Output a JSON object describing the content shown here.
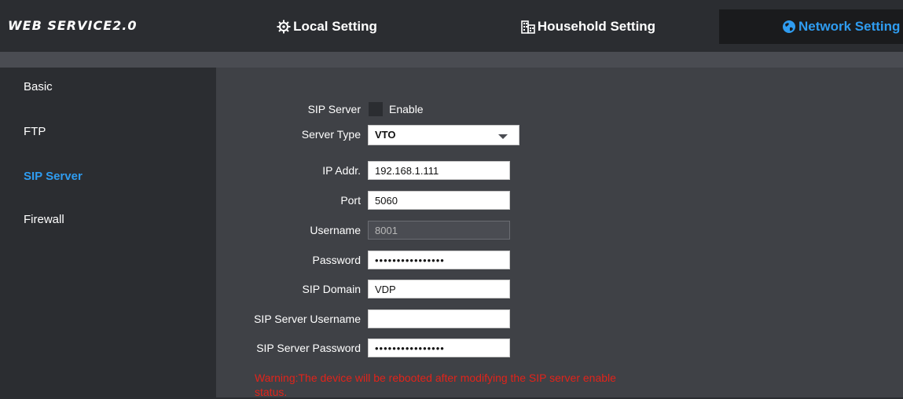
{
  "brand": {
    "title": "WEB SERVICE2.0"
  },
  "nav": {
    "local": {
      "label": "Local Setting",
      "icon": "gear-icon"
    },
    "household": {
      "label": "Household Setting",
      "icon": "building-icon"
    },
    "network": {
      "label": "Network Setting",
      "icon": "globe-icon"
    }
  },
  "sidebar": {
    "items": [
      {
        "label": "Basic"
      },
      {
        "label": "FTP"
      },
      {
        "label": "SIP Server",
        "active": true
      },
      {
        "label": "Firewall"
      }
    ]
  },
  "form": {
    "sip_server": {
      "label": "SIP Server",
      "checkbox_label": "Enable",
      "checked": false
    },
    "server_type": {
      "label": "Server Type",
      "value": "VTO"
    },
    "ip_addr": {
      "label": "IP Addr.",
      "value": "192.168.1.111"
    },
    "port": {
      "label": "Port",
      "value": "5060"
    },
    "username": {
      "label": "Username",
      "value": "8001"
    },
    "password": {
      "label": "Password",
      "value": "••••••••••••••••"
    },
    "sip_domain": {
      "label": "SIP Domain",
      "value": "VDP"
    },
    "sip_server_username": {
      "label": "SIP Server Username",
      "value": ""
    },
    "sip_server_password": {
      "label": "SIP Server Password",
      "value": "••••••••••••••••"
    }
  },
  "warning": "Warning:The device will be rebooted after modifying the SIP server enable status.",
  "colors": {
    "accent": "#2f9cf0",
    "warning": "#e2231a",
    "panel": "#3f4146",
    "background": "#2b2d31"
  }
}
